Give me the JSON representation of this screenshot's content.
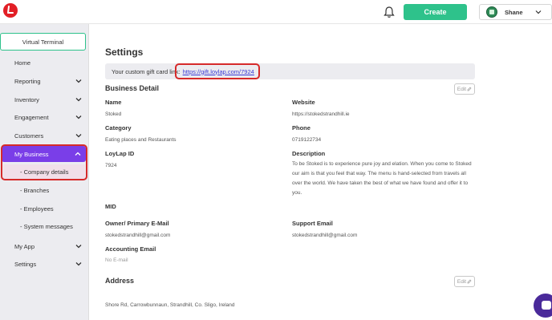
{
  "header": {
    "create_label": "Create",
    "user_name": "Shane"
  },
  "sidebar": {
    "virtual_terminal": "Virtual Terminal",
    "items": [
      {
        "label": "Home"
      },
      {
        "label": "Reporting"
      },
      {
        "label": "Inventory"
      },
      {
        "label": "Engagement"
      },
      {
        "label": "Customers"
      },
      {
        "label": "My Business"
      },
      {
        "label": "My App"
      },
      {
        "label": "Settings"
      }
    ],
    "subitems": [
      {
        "label": "- Company details"
      },
      {
        "label": "- Branches"
      },
      {
        "label": "- Employees"
      },
      {
        "label": "- System messages"
      }
    ]
  },
  "settings": {
    "title": "Settings",
    "gift_text": "Your custom gift card link:",
    "gift_link": "https://gift.loylap.com/7924",
    "business_detail_title": "Business Detail",
    "edit_label": "Edit",
    "fields": {
      "name_label": "Name",
      "name_value": "Stoked",
      "website_label": "Website",
      "website_value": "https://stokedstrandhill.ie",
      "category_label": "Category",
      "category_value": "Eating places and Restaurants",
      "phone_label": "Phone",
      "phone_value": "0719122734",
      "loylap_id_label": "LoyLap ID",
      "loylap_id_value": "7924",
      "description_label": "Description",
      "description_value": "To be Stoked is to experience pure joy and elation. When you come to Stoked our aim is that you feel that way. The menu is hand-selected from travels all over the world.  We have taken the best of what we have found and offer it to you.",
      "mid_label": "MID",
      "owner_email_label": "Owner/ Primary E-Mail",
      "owner_email_value": "stokedstrandhill@gmail.com",
      "support_email_label": "Support Email",
      "support_email_value": "stokedstrandhill@gmail.com",
      "accounting_email_label": "Accounting Email",
      "accounting_email_value": "No E-mail"
    },
    "address_title": "Address",
    "address_value": "Shore Rd, Carrowbunnaun, Strandhill, Co. Sligo, Ireland"
  },
  "colors": {
    "accent_green": "#2ec28b",
    "active_purple": "#7a3ee8",
    "highlight_red": "#d62a2a",
    "logo_red": "#e21f26"
  }
}
